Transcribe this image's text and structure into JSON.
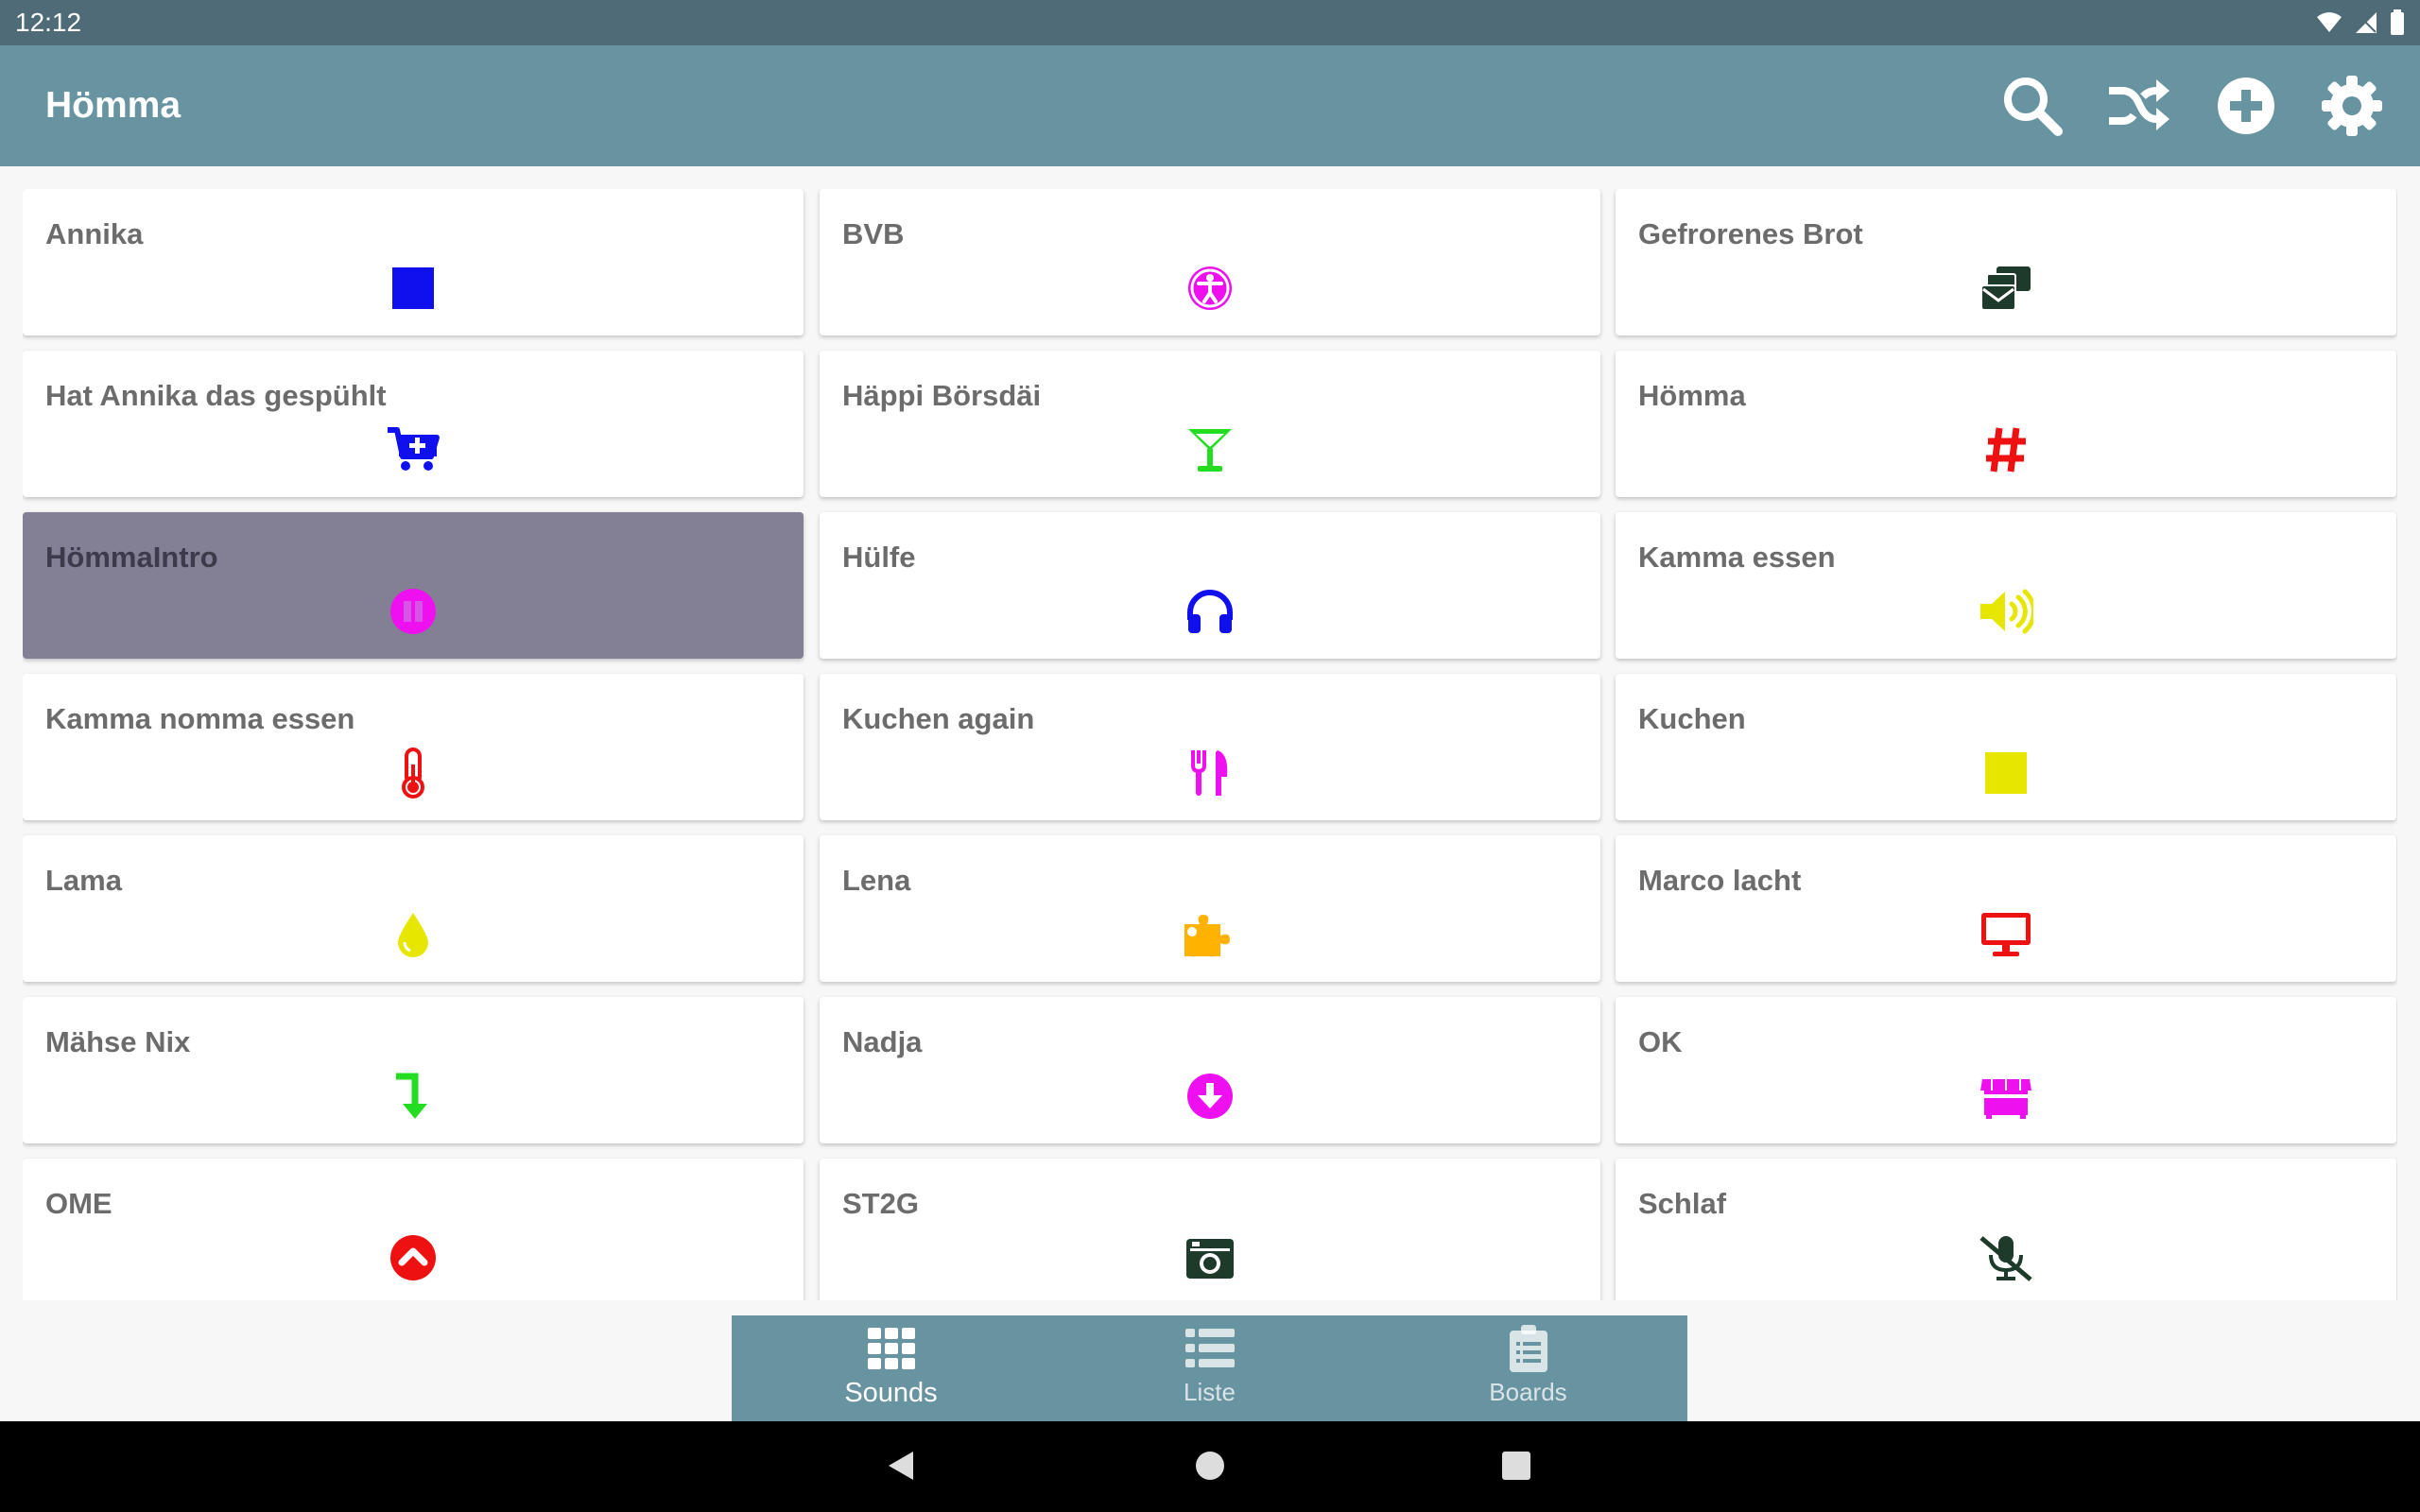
{
  "status": {
    "time": "12:12"
  },
  "app": {
    "title": "Hömma",
    "actions": [
      {
        "name": "search-icon"
      },
      {
        "name": "shuffle-icon"
      },
      {
        "name": "add-circle-icon"
      },
      {
        "name": "settings-gear-icon"
      }
    ]
  },
  "sounds": [
    {
      "label": "Annika",
      "icon": "stop-square-icon",
      "color": "#1010ee"
    },
    {
      "label": "BVB",
      "icon": "accessibility-icon",
      "color": "#ee10ee"
    },
    {
      "label": "Gefrorenes Brot",
      "icon": "mail-bulk-icon",
      "color": "#1e3a2a"
    },
    {
      "label": "Hat Annika das gespühlt",
      "icon": "cart-plus-icon",
      "color": "#1010ee"
    },
    {
      "label": "Häppi Börsdäi",
      "icon": "cocktail-glass-icon",
      "color": "#22dd22"
    },
    {
      "label": "Hömma",
      "icon": "hashtag-icon",
      "color": "#ee1111"
    },
    {
      "label": "HömmaIntro",
      "icon": "pause-circle-icon",
      "color": "#ee10ee",
      "selected": true
    },
    {
      "label": "Hülfe",
      "icon": "headphones-icon",
      "color": "#1010ee"
    },
    {
      "label": "Kamma essen",
      "icon": "volume-up-icon",
      "color": "#e6e600"
    },
    {
      "label": "Kamma nomma essen",
      "icon": "thermometer-icon",
      "color": "#ee1111"
    },
    {
      "label": "Kuchen again",
      "icon": "utensils-icon",
      "color": "#ee10ee"
    },
    {
      "label": "Kuchen",
      "icon": "stop-square-icon",
      "color": "#e6e600"
    },
    {
      "label": "Lama",
      "icon": "tint-drop-icon",
      "color": "#e6e600"
    },
    {
      "label": "Lena",
      "icon": "puzzle-piece-icon",
      "color": "#ffb300"
    },
    {
      "label": "Marco lacht",
      "icon": "desktop-icon",
      "color": "#ee1111"
    },
    {
      "label": "Mähse Nix",
      "icon": "level-down-icon",
      "color": "#22dd22"
    },
    {
      "label": "Nadja",
      "icon": "arrow-circle-down-icon",
      "color": "#ee10ee"
    },
    {
      "label": "OK",
      "icon": "dumpster-icon",
      "color": "#ee10ee"
    },
    {
      "label": "OME",
      "icon": "chevron-circle-up-icon",
      "color": "#ee1111"
    },
    {
      "label": "ST2G",
      "icon": "camera-retro-icon",
      "color": "#1e3a2a"
    },
    {
      "label": "Schlaf",
      "icon": "microphone-slash-icon",
      "color": "#1e3a2a"
    }
  ],
  "nav": {
    "items": [
      {
        "label": "Sounds",
        "icon": "grid-icon",
        "active": true
      },
      {
        "label": "Liste",
        "icon": "list-icon",
        "active": false
      },
      {
        "label": "Boards",
        "icon": "clipboard-icon",
        "active": false
      }
    ]
  }
}
